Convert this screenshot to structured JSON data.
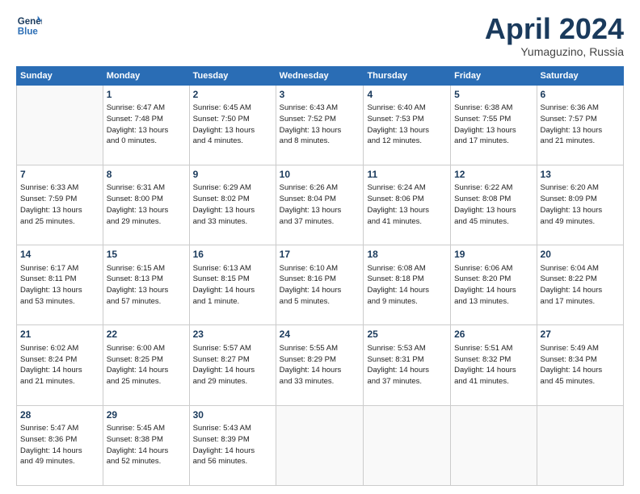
{
  "header": {
    "logo_line1": "General",
    "logo_line2": "Blue",
    "month_title": "April 2024",
    "location": "Yumaguzino, Russia"
  },
  "weekdays": [
    "Sunday",
    "Monday",
    "Tuesday",
    "Wednesday",
    "Thursday",
    "Friday",
    "Saturday"
  ],
  "weeks": [
    [
      {
        "day": null,
        "sunrise": null,
        "sunset": null,
        "daylight": null
      },
      {
        "day": "1",
        "sunrise": "Sunrise: 6:47 AM",
        "sunset": "Sunset: 7:48 PM",
        "daylight": "Daylight: 13 hours and 0 minutes."
      },
      {
        "day": "2",
        "sunrise": "Sunrise: 6:45 AM",
        "sunset": "Sunset: 7:50 PM",
        "daylight": "Daylight: 13 hours and 4 minutes."
      },
      {
        "day": "3",
        "sunrise": "Sunrise: 6:43 AM",
        "sunset": "Sunset: 7:52 PM",
        "daylight": "Daylight: 13 hours and 8 minutes."
      },
      {
        "day": "4",
        "sunrise": "Sunrise: 6:40 AM",
        "sunset": "Sunset: 7:53 PM",
        "daylight": "Daylight: 13 hours and 12 minutes."
      },
      {
        "day": "5",
        "sunrise": "Sunrise: 6:38 AM",
        "sunset": "Sunset: 7:55 PM",
        "daylight": "Daylight: 13 hours and 17 minutes."
      },
      {
        "day": "6",
        "sunrise": "Sunrise: 6:36 AM",
        "sunset": "Sunset: 7:57 PM",
        "daylight": "Daylight: 13 hours and 21 minutes."
      }
    ],
    [
      {
        "day": "7",
        "sunrise": "Sunrise: 6:33 AM",
        "sunset": "Sunset: 7:59 PM",
        "daylight": "Daylight: 13 hours and 25 minutes."
      },
      {
        "day": "8",
        "sunrise": "Sunrise: 6:31 AM",
        "sunset": "Sunset: 8:00 PM",
        "daylight": "Daylight: 13 hours and 29 minutes."
      },
      {
        "day": "9",
        "sunrise": "Sunrise: 6:29 AM",
        "sunset": "Sunset: 8:02 PM",
        "daylight": "Daylight: 13 hours and 33 minutes."
      },
      {
        "day": "10",
        "sunrise": "Sunrise: 6:26 AM",
        "sunset": "Sunset: 8:04 PM",
        "daylight": "Daylight: 13 hours and 37 minutes."
      },
      {
        "day": "11",
        "sunrise": "Sunrise: 6:24 AM",
        "sunset": "Sunset: 8:06 PM",
        "daylight": "Daylight: 13 hours and 41 minutes."
      },
      {
        "day": "12",
        "sunrise": "Sunrise: 6:22 AM",
        "sunset": "Sunset: 8:08 PM",
        "daylight": "Daylight: 13 hours and 45 minutes."
      },
      {
        "day": "13",
        "sunrise": "Sunrise: 6:20 AM",
        "sunset": "Sunset: 8:09 PM",
        "daylight": "Daylight: 13 hours and 49 minutes."
      }
    ],
    [
      {
        "day": "14",
        "sunrise": "Sunrise: 6:17 AM",
        "sunset": "Sunset: 8:11 PM",
        "daylight": "Daylight: 13 hours and 53 minutes."
      },
      {
        "day": "15",
        "sunrise": "Sunrise: 6:15 AM",
        "sunset": "Sunset: 8:13 PM",
        "daylight": "Daylight: 13 hours and 57 minutes."
      },
      {
        "day": "16",
        "sunrise": "Sunrise: 6:13 AM",
        "sunset": "Sunset: 8:15 PM",
        "daylight": "Daylight: 14 hours and 1 minute."
      },
      {
        "day": "17",
        "sunrise": "Sunrise: 6:10 AM",
        "sunset": "Sunset: 8:16 PM",
        "daylight": "Daylight: 14 hours and 5 minutes."
      },
      {
        "day": "18",
        "sunrise": "Sunrise: 6:08 AM",
        "sunset": "Sunset: 8:18 PM",
        "daylight": "Daylight: 14 hours and 9 minutes."
      },
      {
        "day": "19",
        "sunrise": "Sunrise: 6:06 AM",
        "sunset": "Sunset: 8:20 PM",
        "daylight": "Daylight: 14 hours and 13 minutes."
      },
      {
        "day": "20",
        "sunrise": "Sunrise: 6:04 AM",
        "sunset": "Sunset: 8:22 PM",
        "daylight": "Daylight: 14 hours and 17 minutes."
      }
    ],
    [
      {
        "day": "21",
        "sunrise": "Sunrise: 6:02 AM",
        "sunset": "Sunset: 8:24 PM",
        "daylight": "Daylight: 14 hours and 21 minutes."
      },
      {
        "day": "22",
        "sunrise": "Sunrise: 6:00 AM",
        "sunset": "Sunset: 8:25 PM",
        "daylight": "Daylight: 14 hours and 25 minutes."
      },
      {
        "day": "23",
        "sunrise": "Sunrise: 5:57 AM",
        "sunset": "Sunset: 8:27 PM",
        "daylight": "Daylight: 14 hours and 29 minutes."
      },
      {
        "day": "24",
        "sunrise": "Sunrise: 5:55 AM",
        "sunset": "Sunset: 8:29 PM",
        "daylight": "Daylight: 14 hours and 33 minutes."
      },
      {
        "day": "25",
        "sunrise": "Sunrise: 5:53 AM",
        "sunset": "Sunset: 8:31 PM",
        "daylight": "Daylight: 14 hours and 37 minutes."
      },
      {
        "day": "26",
        "sunrise": "Sunrise: 5:51 AM",
        "sunset": "Sunset: 8:32 PM",
        "daylight": "Daylight: 14 hours and 41 minutes."
      },
      {
        "day": "27",
        "sunrise": "Sunrise: 5:49 AM",
        "sunset": "Sunset: 8:34 PM",
        "daylight": "Daylight: 14 hours and 45 minutes."
      }
    ],
    [
      {
        "day": "28",
        "sunrise": "Sunrise: 5:47 AM",
        "sunset": "Sunset: 8:36 PM",
        "daylight": "Daylight: 14 hours and 49 minutes."
      },
      {
        "day": "29",
        "sunrise": "Sunrise: 5:45 AM",
        "sunset": "Sunset: 8:38 PM",
        "daylight": "Daylight: 14 hours and 52 minutes."
      },
      {
        "day": "30",
        "sunrise": "Sunrise: 5:43 AM",
        "sunset": "Sunset: 8:39 PM",
        "daylight": "Daylight: 14 hours and 56 minutes."
      },
      {
        "day": null,
        "sunrise": null,
        "sunset": null,
        "daylight": null
      },
      {
        "day": null,
        "sunrise": null,
        "sunset": null,
        "daylight": null
      },
      {
        "day": null,
        "sunrise": null,
        "sunset": null,
        "daylight": null
      },
      {
        "day": null,
        "sunrise": null,
        "sunset": null,
        "daylight": null
      }
    ]
  ]
}
